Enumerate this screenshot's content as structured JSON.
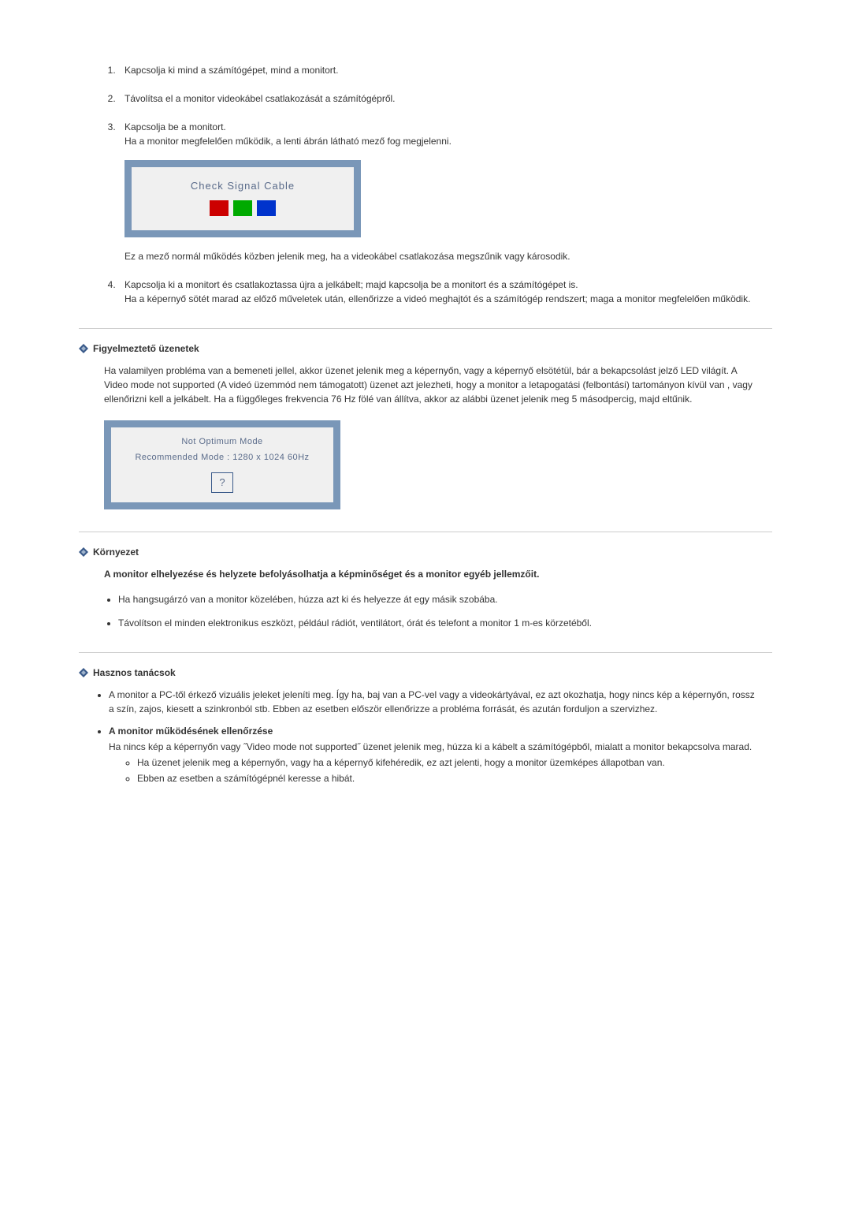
{
  "steps": {
    "s1": "Kapcsolja ki mind a számítógépet, mind a monitort.",
    "s2": "Távolítsa el a monitor videokábel csatlakozását a számítógépről.",
    "s3a": "Kapcsolja be a monitort.",
    "s3b": "Ha a monitor megfelelően működik, a lenti ábrán látható mező fog megjelenni.",
    "s3_box": "Check Signal Cable",
    "s3c": "Ez a mező normál működés közben jelenik meg, ha a videokábel csatlakozása megszűnik vagy károsodik.",
    "s4a": "Kapcsolja ki a monitort és csatlakoztassa újra a jelkábelt; majd kapcsolja be a monitort és a számítógépet is.",
    "s4b": "Ha a képernyő sötét marad az előző műveletek után, ellenőrizze a videó meghajtót és a számítógép rendszert; maga a monitor megfelelően működik."
  },
  "warning": {
    "title": "Figyelmeztető üzenetek",
    "body": "Ha valamilyen probléma van a bemeneti jellel, akkor üzenet jelenik meg a képernyőn, vagy a képernyő elsötétül, bár a bekapcsolást jelző LED világít. A Video mode not supported (A videó üzemmód nem támogatott) üzenet azt jelezheti, hogy a monitor a letapogatási (felbontási) tartományon kívül van , vagy ellenőrizni kell a jelkábelt. Ha a függőleges frekvencia 76 Hz fölé van állítva, akkor az alábbi üzenet jelenik meg 5 másodpercig, majd eltűnik.",
    "box_line1": "Not Optimum Mode",
    "box_line2": "Recommended Mode : 1280 x 1024  60Hz",
    "box_q": "?"
  },
  "env": {
    "title": "Környezet",
    "intro": "A monitor elhelyezése és helyzete befolyásolhatja a képminőséget és a monitor egyéb jellemzőit.",
    "b1": "Ha hangsugárzó van a monitor közelében, húzza azt ki és helyezze át egy másik szobába.",
    "b2": "Távolítson el minden elektronikus eszközt, például rádiót, ventilátort, órát és telefont a monitor 1 m-es körzetéből."
  },
  "tips": {
    "title": "Hasznos tanácsok",
    "b1": "A monitor a PC-től érkező vizuális jeleket jeleníti meg. Így ha, baj van a PC-vel vagy a videokártyával, ez azt okozhatja, hogy nincs kép a képernyőn, rossz a szín, zajos, kiesett a szinkronból stb. Ebben az esetben először ellenőrizze a probléma forrását, és azután forduljon a szervizhez.",
    "b2_title": "A monitor működésének ellenőrzése",
    "b2_body": "Ha nincs kép a képernyőn vagy ˝Video mode not supported˝ üzenet jelenik meg, húzza ki a kábelt a számítógépből, mialatt a monitor bekapcsolva marad.",
    "b2_sub1": "Ha üzenet jelenik meg a képernyőn, vagy ha a képernyő kifehéredik, ez azt jelenti, hogy a monitor üzemképes állapotban van.",
    "b2_sub2": "Ebben az esetben a számítógépnél keresse a hibát."
  }
}
